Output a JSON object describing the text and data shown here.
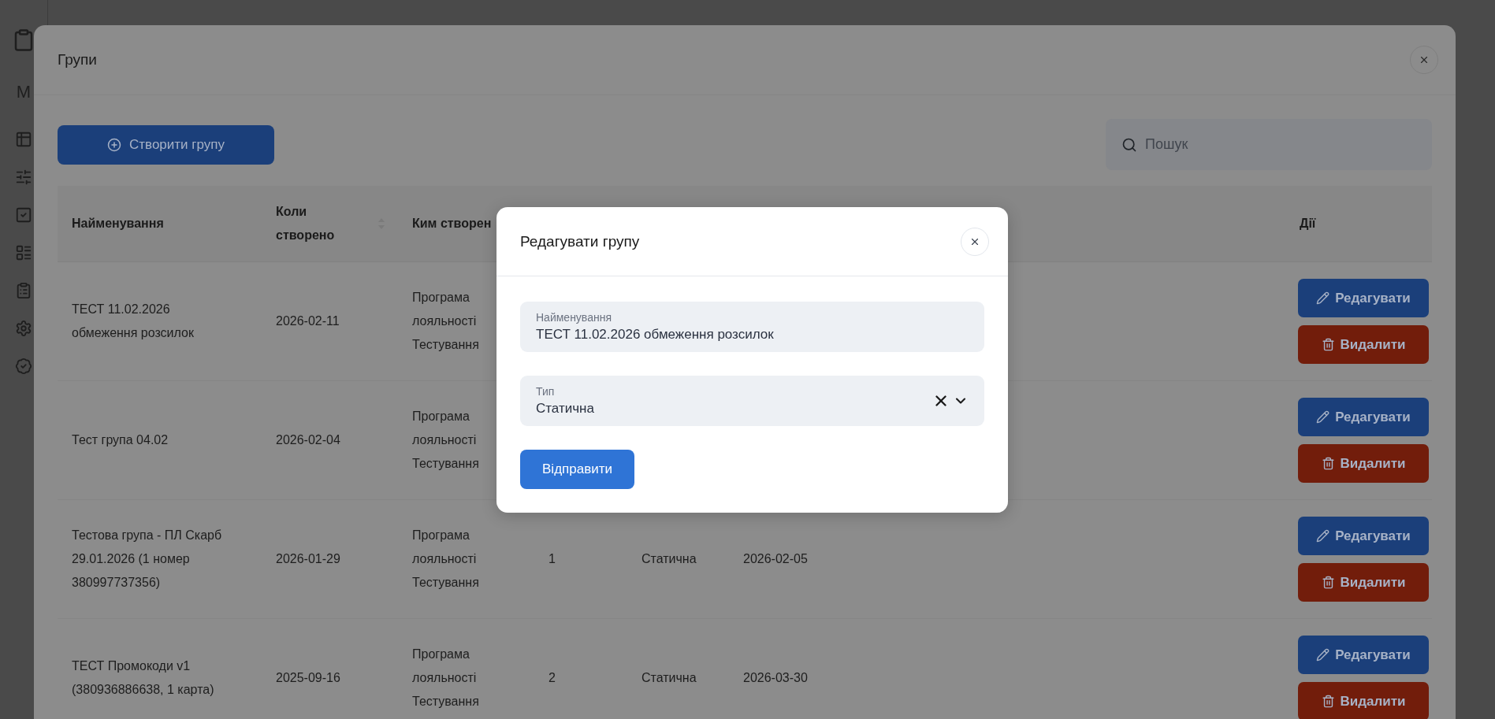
{
  "background": {
    "sidebar_heading": "М"
  },
  "groups_dialog": {
    "title": "Групи",
    "create_button": "Створити групу",
    "search": {
      "placeholder": "Пошук"
    },
    "table": {
      "columns": [
        {
          "label": "Найменування",
          "sortable": false
        },
        {
          "label": "Коли створено",
          "sortable": true
        },
        {
          "label": "Ким створен",
          "sortable": false
        },
        {
          "label": "Дії",
          "sortable": false
        }
      ],
      "rows": [
        {
          "name": "ТЕСТ 11.02.2026 обмеження розсилок",
          "created": "2026-02-11",
          "author": "Програма лояльності Тестування",
          "edit": "Редагувати",
          "delete": "Видалити"
        },
        {
          "name": "Тест група 04.02",
          "created": "2026-02-04",
          "author": "Програма лояльності Тестування",
          "edit": "Редагувати",
          "delete": "Видалити"
        },
        {
          "name": "Тестова група - ПЛ Скарб 29.01.2026 (1 номер 380997737356)",
          "created": "2026-01-29",
          "author": "Програма лояльності Тестування",
          "column_4": "1",
          "column_5": "Статична",
          "column_6": "2026-02-05",
          "edit": "Редагувати",
          "delete": "Видалити"
        },
        {
          "name": "ТЕСТ Промокоди v1 (380936886638, 1 карта)",
          "created": "2025-09-16",
          "author": "Програма лояльності Тестування",
          "column_4": "2",
          "column_5": "Статична",
          "column_6": "2026-03-30",
          "edit": "Редагувати",
          "delete": "Видалити"
        }
      ]
    }
  },
  "edit_dialog": {
    "title": "Редагувати групу",
    "fields": [
      {
        "kind": "text",
        "label": "Найменування",
        "value": "ТЕСТ 11.02.2026 обмеження розсилок"
      },
      {
        "kind": "select",
        "label": "Тип",
        "value": "Статична",
        "clearable": true
      }
    ],
    "submit": "Відправити"
  }
}
